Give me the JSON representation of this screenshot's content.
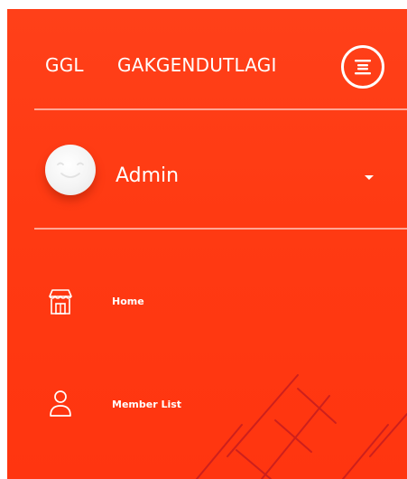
{
  "brand": {
    "short": "GGL",
    "name": "GAKGENDUTLAGI"
  },
  "toggle": {
    "icon": "menu-lines-icon"
  },
  "user": {
    "name": "Admin",
    "avatar_icon": "smiley-face-icon",
    "caret_icon": "caret-down-icon"
  },
  "menu": [
    {
      "label": "Home",
      "icon": "storefront-icon"
    },
    {
      "label": "Member List",
      "icon": "user-outline-icon"
    }
  ],
  "watermark": {
    "icon": "diagonal-watermark-strokes"
  },
  "colors": {
    "sidebar": "#ff3a12",
    "text": "#ffffff",
    "watermark": "#c81e1e"
  }
}
